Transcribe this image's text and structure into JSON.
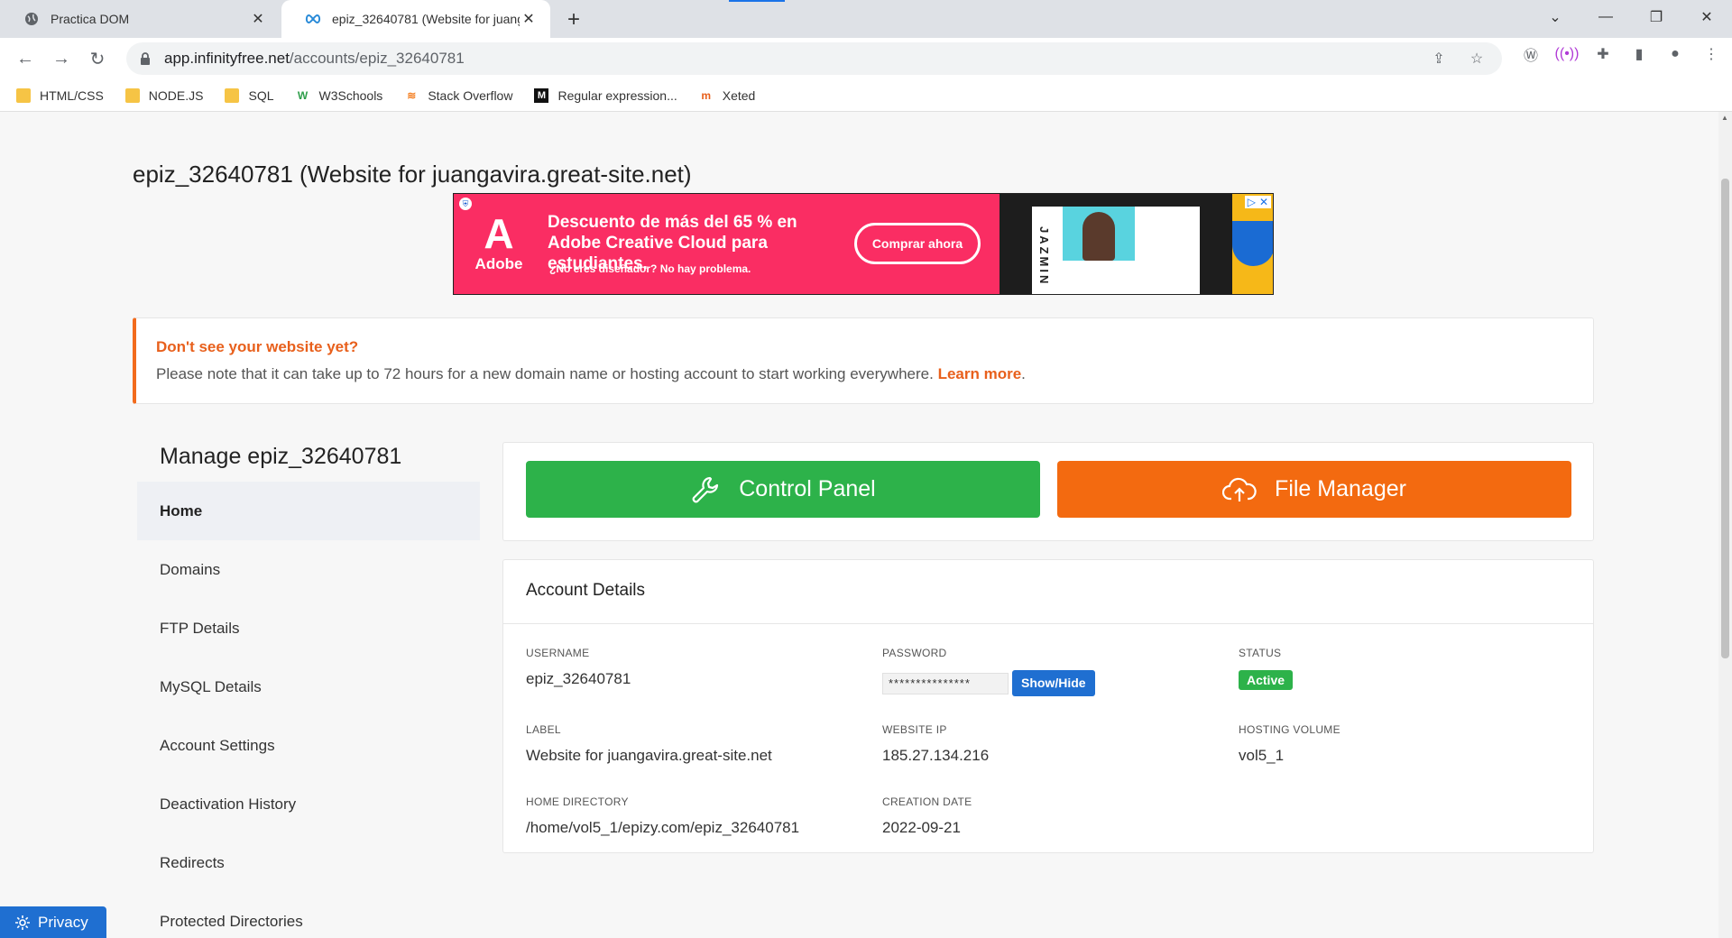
{
  "browser": {
    "tabs": [
      {
        "title": "Practica DOM",
        "active": false
      },
      {
        "title": "epiz_32640781 (Website for juang",
        "active": true
      }
    ],
    "url_host": "app.infinityfree.net",
    "url_path": "/accounts/epiz_32640781",
    "bookmarks": [
      {
        "label": "HTML/CSS",
        "icon": "folder-icon"
      },
      {
        "label": "NODE.JS",
        "icon": "folder-icon"
      },
      {
        "label": "SQL",
        "icon": "folder-icon"
      },
      {
        "label": "W3Schools",
        "icon": "w3schools-icon"
      },
      {
        "label": "Stack Overflow",
        "icon": "stackoverflow-icon"
      },
      {
        "label": "Regular expression...",
        "icon": "regex-icon"
      },
      {
        "label": "Xeted",
        "icon": "xeted-icon"
      }
    ]
  },
  "page": {
    "title": "epiz_32640781 (Website for juangavira.great-site.net)"
  },
  "ad": {
    "brand": "Adobe",
    "headline": "Descuento de más del 65 % en Adobe Creative Cloud para estudiantes.",
    "subline": "¿No eres diseñador? No hay problema.",
    "cta": "Comprar ahora",
    "vertical_name": "JAZMIN",
    "colors": {
      "background": "#fa2d63"
    }
  },
  "notice": {
    "title": "Don't see your website yet?",
    "text": "Please note that it can take up to 72 hours for a new domain name or hosting account to start working everywhere.",
    "link": "Learn more",
    "accent": "#e8601c"
  },
  "sidebar": {
    "title": "Manage epiz_32640781",
    "items": [
      {
        "label": "Home",
        "active": true
      },
      {
        "label": "Domains"
      },
      {
        "label": "FTP Details"
      },
      {
        "label": "MySQL Details"
      },
      {
        "label": "Account Settings"
      },
      {
        "label": "Deactivation History"
      },
      {
        "label": "Redirects"
      },
      {
        "label": "Protected Directories"
      }
    ]
  },
  "actions": {
    "control_panel": "Control Panel",
    "file_manager": "File Manager",
    "colors": {
      "control_panel": "#2db24a",
      "file_manager": "#f36a10"
    }
  },
  "details": {
    "heading": "Account Details",
    "username_label": "USERNAME",
    "username": "epiz_32640781",
    "password_label": "PASSWORD",
    "password_masked": "***************",
    "show_hide": "Show/Hide",
    "status_label": "STATUS",
    "status": "Active",
    "label_label": "LABEL",
    "label": "Website for juangavira.great-site.net",
    "ip_label": "WEBSITE IP",
    "ip": "185.27.134.216",
    "volume_label": "HOSTING VOLUME",
    "volume": "vol5_1",
    "homedir_label": "HOME DIRECTORY",
    "homedir": "/home/vol5_1/epizy.com/epiz_32640781",
    "created_label": "CREATION DATE",
    "created": "2022-09-21"
  },
  "privacy": {
    "label": "Privacy"
  }
}
